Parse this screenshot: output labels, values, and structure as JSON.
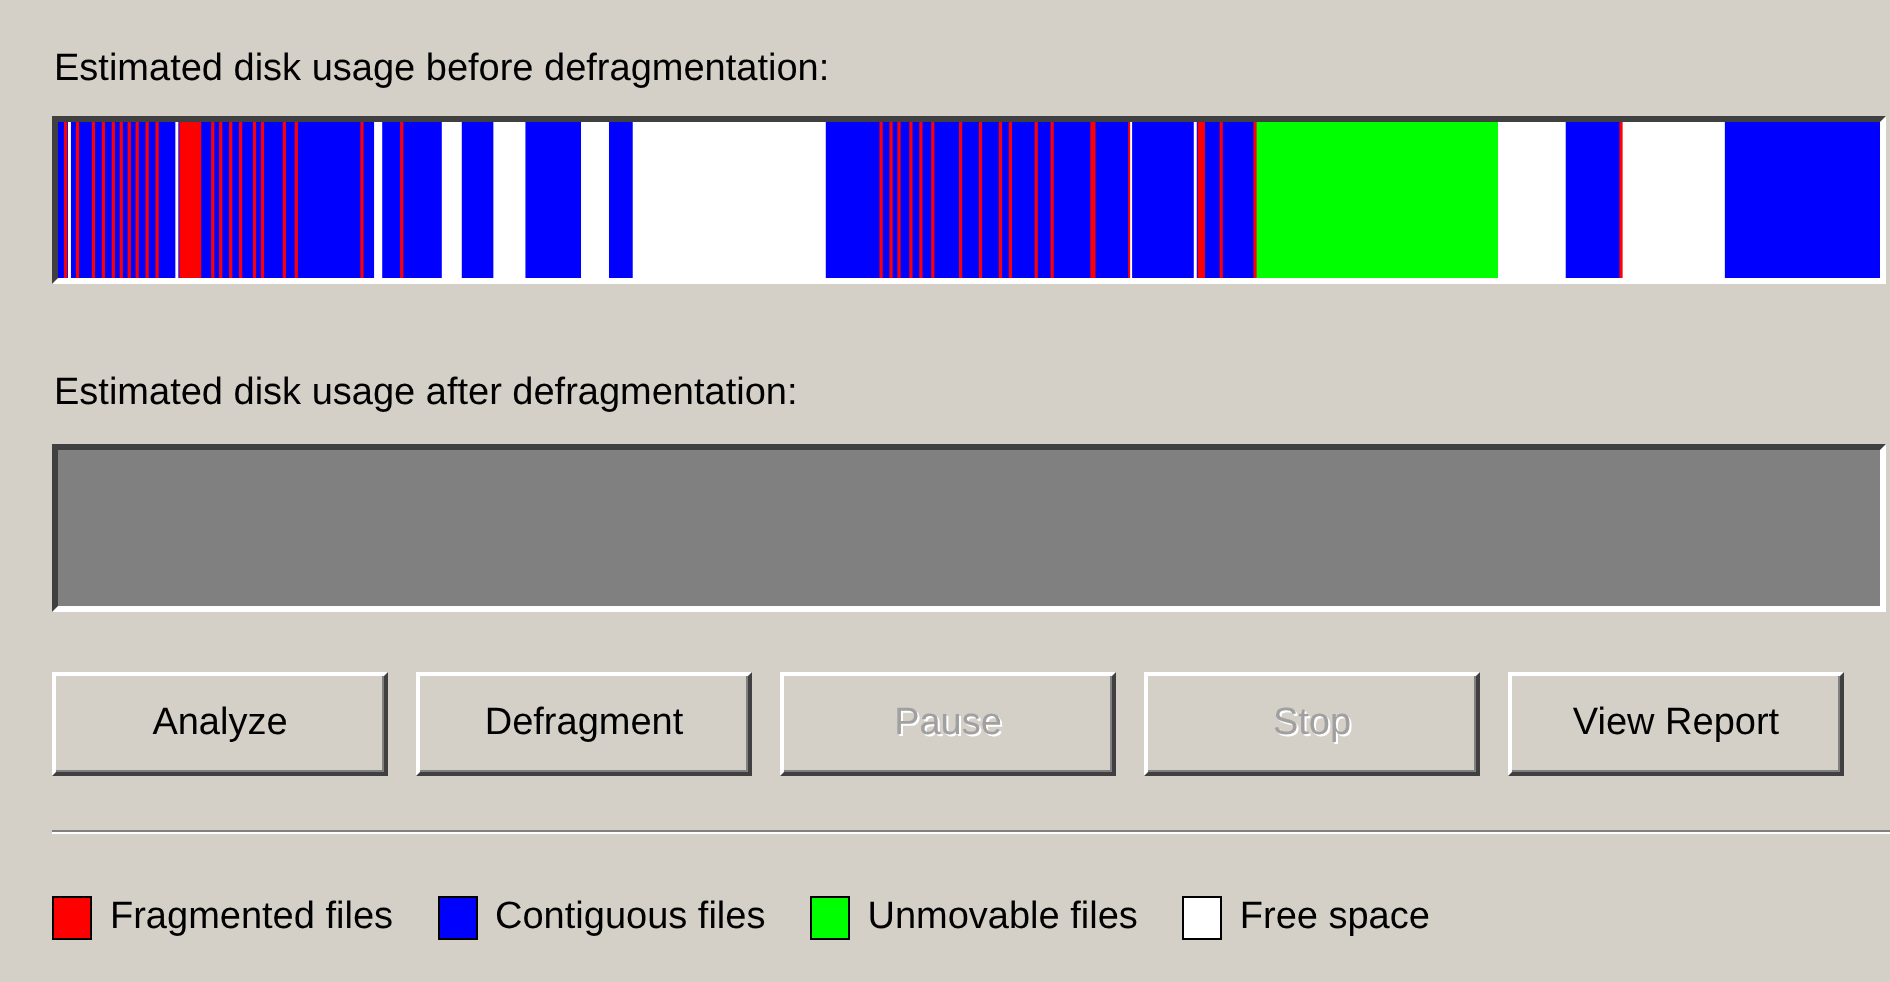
{
  "before": {
    "label": "Estimated disk usage before defragmentation:"
  },
  "after": {
    "label": "Estimated disk usage after defragmentation:"
  },
  "buttons": [
    {
      "label": "Analyze",
      "disabled": false
    },
    {
      "label": "Defragment",
      "disabled": false
    },
    {
      "label": "Pause",
      "disabled": true
    },
    {
      "label": "Stop",
      "disabled": true
    },
    {
      "label": "View Report",
      "disabled": false
    }
  ],
  "legend": [
    {
      "kind": "fragmented",
      "label": "Fragmented files",
      "color": "#ff0000"
    },
    {
      "kind": "contiguous",
      "label": "Contiguous files",
      "color": "#0000ff"
    },
    {
      "kind": "unmovable",
      "label": "Unmovable files",
      "color": "#00ff00"
    },
    {
      "kind": "free",
      "label": "Free space",
      "color": "#ffffff"
    }
  ]
}
